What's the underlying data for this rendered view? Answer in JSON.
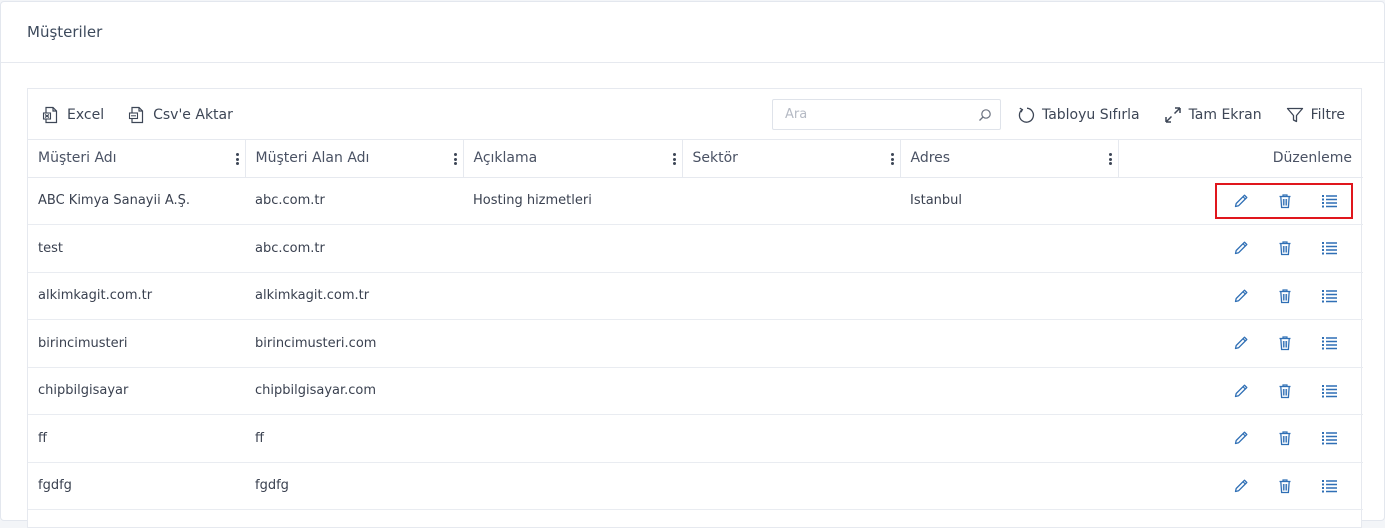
{
  "page": {
    "title": "Müşteriler"
  },
  "toolbar": {
    "excel_label": "Excel",
    "csv_label": "Csv'e Aktar",
    "search_placeholder": "Ara",
    "reset_label": "Tabloyu Sıfırla",
    "fullscreen_label": "Tam Ekran",
    "filter_label": "Filtre"
  },
  "table": {
    "columns": [
      "Müşteri Adı",
      "Müşteri Alan Adı",
      "Açıklama",
      "Sektör",
      "Adres",
      "Düzenleme"
    ],
    "rows": [
      [
        "ABC Kimya Sanayii A.Ş.",
        "abc.com.tr",
        "Hosting hizmetleri",
        "",
        "Istanbul"
      ],
      [
        "test",
        "abc.com.tr",
        "",
        "",
        ""
      ],
      [
        "alkimkagit.com.tr",
        "alkimkagit.com.tr",
        "",
        "",
        ""
      ],
      [
        "birincimusteri",
        "birincimusteri.com",
        "",
        "",
        ""
      ],
      [
        "chipbilgisayar",
        "chipbilgisayar.com",
        "",
        "",
        ""
      ],
      [
        "ff",
        "ff",
        "",
        "",
        ""
      ],
      [
        "fgdfg",
        "fgdfg",
        "",
        "",
        ""
      ]
    ]
  },
  "colors": {
    "icon_blue": "#2f6fb5",
    "highlight_red": "#e0161d"
  },
  "icons": {
    "edit": "pencil-icon",
    "delete": "trash-icon",
    "details": "list-icon"
  }
}
